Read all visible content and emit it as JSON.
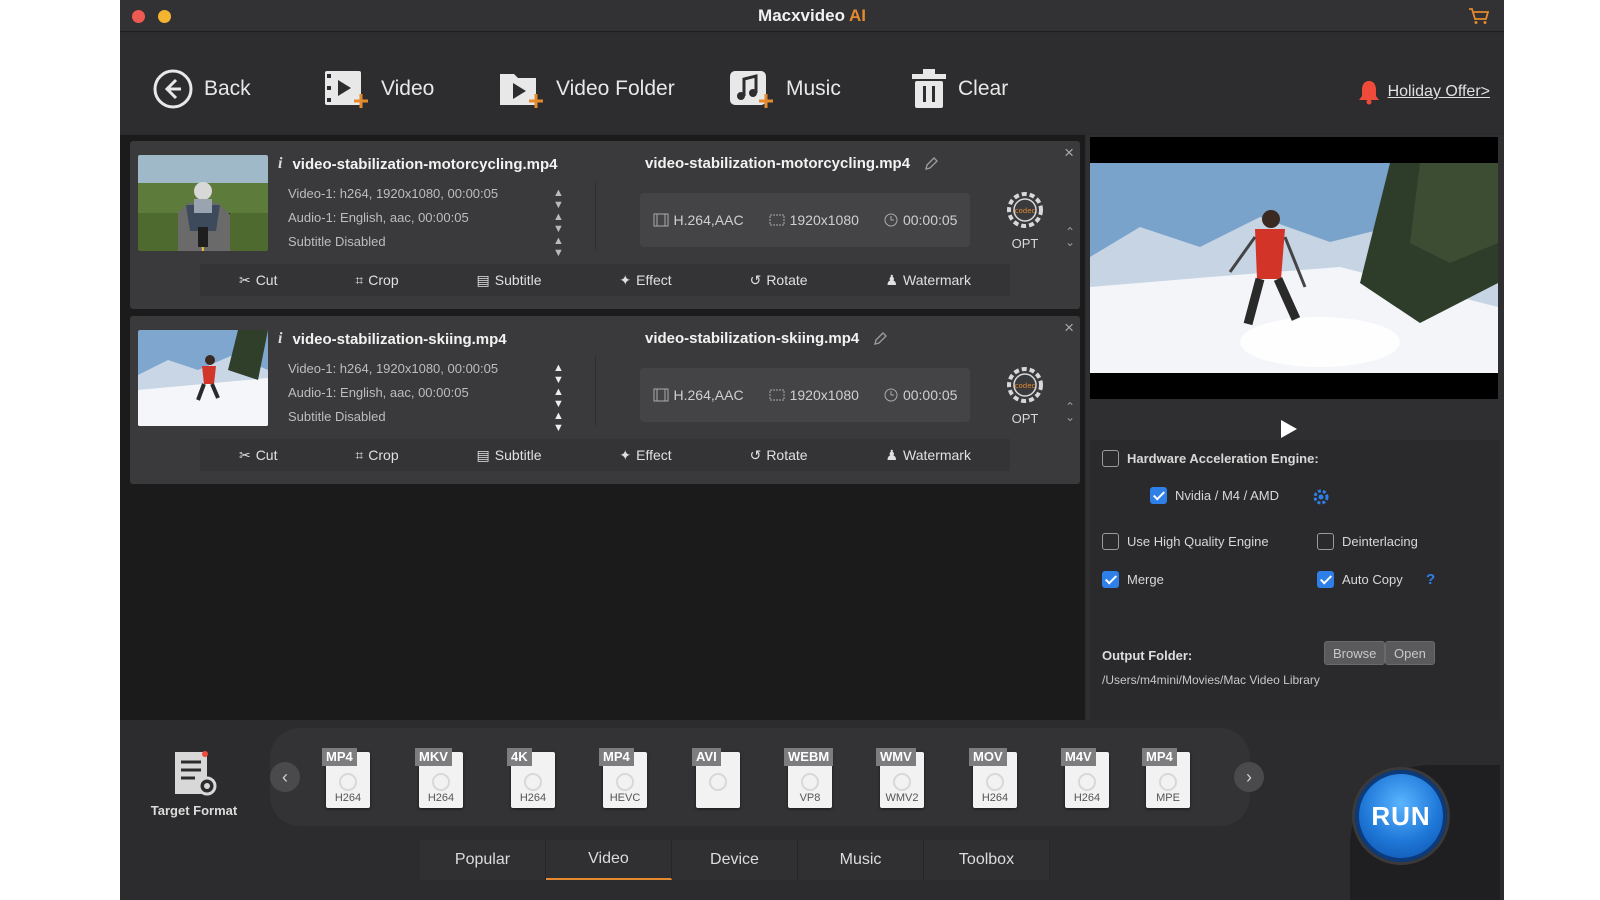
{
  "app": {
    "title": "Macxvideo",
    "title_accent": "AI",
    "accent_color": "#e58a2e"
  },
  "toolbar": {
    "back_label": "Back",
    "video_label": "Video",
    "video_folder_label": "Video Folder",
    "music_label": "Music",
    "clear_label": "Clear",
    "holiday_label": "Holiday Offer>"
  },
  "files": [
    {
      "source_name": "video-stabilization-motorcycling.mp4",
      "video_track": "Video-1: h264, 1920x1080, 00:00:05",
      "audio_track": "Audio-1: English, aac, 00:00:05",
      "subtitle": "Subtitle Disabled",
      "output_name": "video-stabilization-motorcycling.mp4",
      "codec": "H.264,AAC",
      "resolution": "1920x1080",
      "duration": "00:00:05",
      "opt_label": "OPT",
      "edit": {
        "cut": "Cut",
        "crop": "Crop",
        "subtitle": "Subtitle",
        "effect": "Effect",
        "rotate": "Rotate",
        "watermark": "Watermark"
      }
    },
    {
      "source_name": "video-stabilization-skiing.mp4",
      "video_track": "Video-1: h264, 1920x1080, 00:00:05",
      "audio_track": "Audio-1: English, aac, 00:00:05",
      "subtitle": "Subtitle Disabled",
      "output_name": "video-stabilization-skiing.mp4",
      "codec": "H.264,AAC",
      "resolution": "1920x1080",
      "duration": "00:00:05",
      "opt_label": "OPT",
      "edit": {
        "cut": "Cut",
        "crop": "Crop",
        "subtitle": "Subtitle",
        "effect": "Effect",
        "rotate": "Rotate",
        "watermark": "Watermark"
      }
    }
  ],
  "settings": {
    "hw_accel_label": "Hardware Acceleration Engine:",
    "hw_accel_checked": false,
    "gpu_label": "Nvidia / M4 / AMD",
    "gpu_checked": true,
    "high_quality_label": "Use High Quality Engine",
    "high_quality_checked": false,
    "deinterlacing_label": "Deinterlacing",
    "deinterlacing_checked": false,
    "merge_label": "Merge",
    "merge_checked": true,
    "auto_copy_label": "Auto Copy",
    "auto_copy_checked": true,
    "help_label": "?",
    "output_folder_label": "Output Folder:",
    "output_path": "/Users/m4mini/Movies/Mac Video Library",
    "browse_label": "Browse",
    "open_label": "Open"
  },
  "target_format_label": "Target Format",
  "formats": [
    {
      "label": "MP4",
      "codec": "H264"
    },
    {
      "label": "MKV",
      "codec": "H264"
    },
    {
      "label": "4K",
      "codec": "H264"
    },
    {
      "label": "MP4",
      "codec": "HEVC"
    },
    {
      "label": "AVI",
      "codec": ""
    },
    {
      "label": "WEBM",
      "codec": "VP8"
    },
    {
      "label": "WMV",
      "codec": "WMV2"
    },
    {
      "label": "MOV",
      "codec": "H264"
    },
    {
      "label": "M4V",
      "codec": "H264"
    },
    {
      "label": "MP4",
      "codec": "MPE"
    }
  ],
  "tabs": [
    {
      "label": "Popular",
      "active": false
    },
    {
      "label": "Video",
      "active": true
    },
    {
      "label": "Device",
      "active": false
    },
    {
      "label": "Music",
      "active": false
    },
    {
      "label": "Toolbox",
      "active": false
    }
  ],
  "run_label": "RUN"
}
